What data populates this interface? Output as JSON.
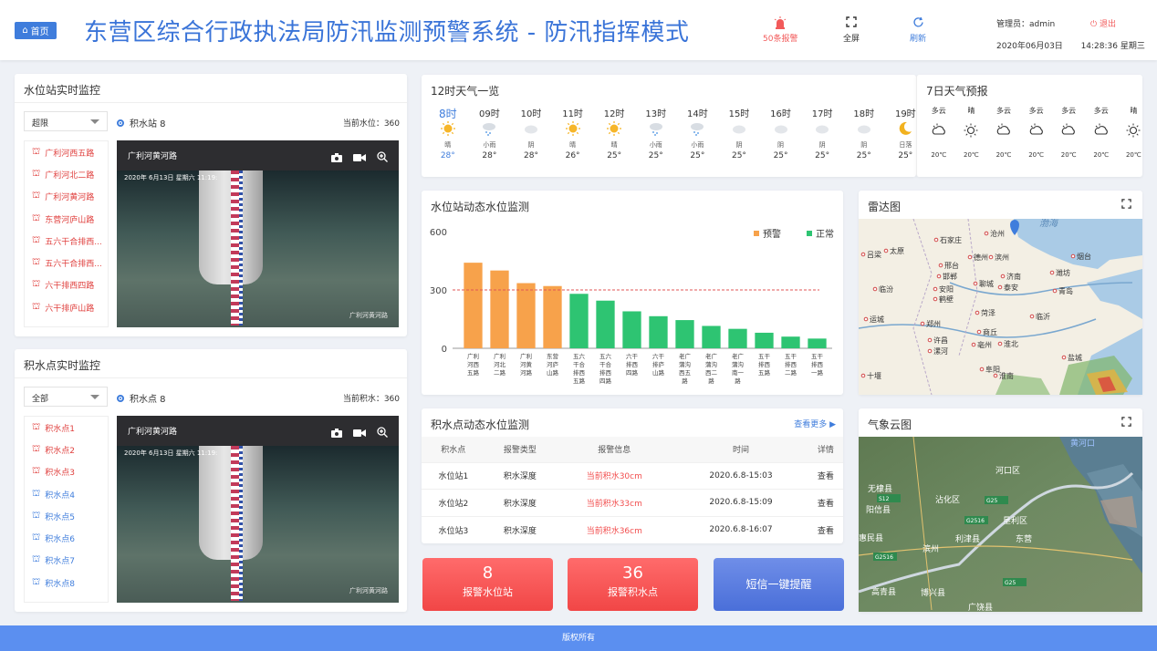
{
  "header": {
    "home_label": "首页",
    "title": "东营区综合行政执法局防汛监测预警系统 - 防汛指挥模式",
    "alarm_label": "50条报警",
    "fullscreen_label": "全屏",
    "refresh_label": "刷新",
    "admin_label": "管理员：admin",
    "logout_label": "退出",
    "date": "2020年06月03日",
    "time": "14:28:36",
    "weekday": "星期三"
  },
  "water_station": {
    "title": "水位站实时监控",
    "filter": "超限",
    "selected": "积水站 8",
    "current_label": "当前水位：360",
    "items": [
      {
        "label": "广利河西五路",
        "color": "#e0413f"
      },
      {
        "label": "广利河北二路",
        "color": "#e0413f"
      },
      {
        "label": "广利河黄河路",
        "color": "#e0413f"
      },
      {
        "label": "东营河庐山路",
        "color": "#e0413f"
      },
      {
        "label": "五六干合排西...",
        "color": "#e0413f"
      },
      {
        "label": "五六干合排西...",
        "color": "#e0413f"
      },
      {
        "label": "六干排西四路",
        "color": "#e0413f"
      },
      {
        "label": "六干排庐山路",
        "color": "#e0413f"
      }
    ],
    "video_title": "广利河黄河路",
    "video_timestamp": "2020年 6月13日  星期六  11:19:",
    "video_watermark": "广利河黄河路"
  },
  "waterlog": {
    "title": "积水点实时监控",
    "filter": "全部",
    "selected": "积水点 8",
    "current_label": "当前积水：360",
    "items": [
      {
        "label": "积水点1",
        "color": "#e0413f"
      },
      {
        "label": "积水点2",
        "color": "#e0413f"
      },
      {
        "label": "积水点3",
        "color": "#e0413f"
      },
      {
        "label": "积水点4",
        "color": "#3f7ddc"
      },
      {
        "label": "积水点5",
        "color": "#3f7ddc"
      },
      {
        "label": "积水点6",
        "color": "#3f7ddc"
      },
      {
        "label": "积水点7",
        "color": "#3f7ddc"
      },
      {
        "label": "积水点8",
        "color": "#3f7ddc"
      }
    ],
    "video_title": "广利河黄河路",
    "video_timestamp": "2020年 6月13日  星期六  11:19:",
    "video_watermark": "广利河黄河路"
  },
  "weather12": {
    "title": "12时天气一览",
    "hours": [
      {
        "time": "8时",
        "icon": "sun",
        "desc": "晴",
        "temp": "28°"
      },
      {
        "time": "09时",
        "icon": "rain",
        "desc": "小雨",
        "temp": "28°"
      },
      {
        "time": "10时",
        "icon": "cloud",
        "desc": "阴",
        "temp": "28°"
      },
      {
        "time": "11时",
        "icon": "sun",
        "desc": "晴",
        "temp": "26°"
      },
      {
        "time": "12时",
        "icon": "sun",
        "desc": "晴",
        "temp": "25°"
      },
      {
        "time": "13时",
        "icon": "rain",
        "desc": "小雨",
        "temp": "25°"
      },
      {
        "time": "14时",
        "icon": "rain",
        "desc": "小雨",
        "temp": "25°"
      },
      {
        "time": "15时",
        "icon": "cloud",
        "desc": "阴",
        "temp": "25°"
      },
      {
        "time": "16时",
        "icon": "cloud",
        "desc": "阴",
        "temp": "25°"
      },
      {
        "time": "17时",
        "icon": "cloud",
        "desc": "阴",
        "temp": "25°"
      },
      {
        "time": "18时",
        "icon": "cloud",
        "desc": "阴",
        "temp": "25°"
      },
      {
        "time": "19时",
        "icon": "moon",
        "desc": "日落",
        "temp": "25°"
      }
    ]
  },
  "weather7": {
    "title": "7日天气预报",
    "days": [
      {
        "desc": "多云",
        "icon": "partly-cloudy",
        "temp": "20℃"
      },
      {
        "desc": "晴",
        "icon": "sun",
        "temp": "20℃"
      },
      {
        "desc": "多云",
        "icon": "partly-cloudy",
        "temp": "20℃"
      },
      {
        "desc": "多云",
        "icon": "partly-cloudy",
        "temp": "20℃"
      },
      {
        "desc": "多云",
        "icon": "partly-cloudy",
        "temp": "20℃"
      },
      {
        "desc": "多云",
        "icon": "partly-cloudy",
        "temp": "20℃"
      },
      {
        "desc": "晴",
        "icon": "sun",
        "temp": "20℃"
      }
    ]
  },
  "chart_panel": {
    "title": "水位站动态水位监测"
  },
  "chart_data": {
    "type": "bar",
    "ylim": [
      0,
      600
    ],
    "yticks": [
      0,
      300,
      600
    ],
    "threshold": 300,
    "legend": [
      "预警",
      "正常"
    ],
    "colors": {
      "warn": "#f7a24b",
      "normal": "#2ec472",
      "threshold": "#e05555"
    },
    "categories": [
      "广利河西五路",
      "广利河北二路",
      "广利河黄河路",
      "东营河庐山路",
      "五六干合排西五路",
      "五六干合排西四路",
      "六干排西四路",
      "六干排庐山路",
      "老广蒲沟西五路",
      "老广蒲沟西二路",
      "老广蒲沟南一路",
      "五干排西五路",
      "五干排西二路",
      "五干排西一路"
    ],
    "category_labels": [
      [
        "广利",
        "河西",
        "五路"
      ],
      [
        "广利",
        "河北",
        "二路"
      ],
      [
        "广利",
        "河黄",
        "河路"
      ],
      [
        "东营",
        "河庐",
        "山路"
      ],
      [
        "五六",
        "干合",
        "排西",
        "五路"
      ],
      [
        "五六",
        "干合",
        "排西",
        "四路"
      ],
      [
        "六干",
        "排西",
        "四路"
      ],
      [
        "六干",
        "排庐",
        "山路"
      ],
      [
        "老广",
        "蒲沟",
        "西五",
        "路"
      ],
      [
        "老广",
        "蒲沟",
        "西二",
        "路"
      ],
      [
        "老广",
        "蒲沟",
        "南一",
        "路"
      ],
      [
        "五干",
        "排西",
        "五路"
      ],
      [
        "五干",
        "排西",
        "二路"
      ],
      [
        "五干",
        "排西",
        "一路"
      ]
    ],
    "values": [
      440,
      400,
      335,
      320,
      280,
      245,
      190,
      165,
      145,
      115,
      100,
      80,
      60,
      50
    ],
    "status": [
      "预警",
      "预警",
      "预警",
      "预警",
      "正常",
      "正常",
      "正常",
      "正常",
      "正常",
      "正常",
      "正常",
      "正常",
      "正常",
      "正常"
    ]
  },
  "radar": {
    "title": "雷达图",
    "sea_label": "渤海",
    "cities": [
      "石家庄",
      "太原",
      "吕梁",
      "沧州",
      "滨州",
      "烟台",
      "德州",
      "济南",
      "潍坊",
      "邢台",
      "邯郸",
      "聊城",
      "泰安",
      "青岛",
      "临汾",
      "安阳",
      "鹤壁",
      "运城",
      "菏泽",
      "临沂",
      "郑州",
      "商丘",
      "许昌",
      "漯河",
      "亳州",
      "淮北",
      "盐城",
      "阜阳",
      "十堰",
      "淮南"
    ]
  },
  "waterlog_table": {
    "title": "积水点动态水位监测",
    "more_label": "查看更多",
    "headers": [
      "积水点",
      "报警类型",
      "报警信息",
      "时间",
      "详情"
    ],
    "rows": [
      [
        "水位站1",
        "积水深度",
        "当前积水30cm",
        "2020.6.8-15:03",
        "查看"
      ],
      [
        "水位站2",
        "积水深度",
        "当前积水33cm",
        "2020.6.8-15:09",
        "查看"
      ],
      [
        "水位站3",
        "积水深度",
        "当前积水36cm",
        "2020.6.8-16:07",
        "查看"
      ]
    ]
  },
  "cloud": {
    "title": "气象云图",
    "labels": [
      "黄河口",
      "河口区",
      "无棣县",
      "沾化区",
      "阳信县",
      "垦利区",
      "东营",
      "利津县",
      "惠民县",
      "滨州",
      "博兴县",
      "高青县",
      "广饶县"
    ],
    "road_labels": [
      "S12",
      "G25",
      "G2516",
      "G2516",
      "G25"
    ]
  },
  "stats": {
    "warn_station_count": "8",
    "warn_station_label": "报警水位站",
    "warn_point_count": "36",
    "warn_point_label": "报警积水点",
    "sms_label": "短信一键提醒"
  },
  "footer": {
    "copyright": "版权所有"
  }
}
